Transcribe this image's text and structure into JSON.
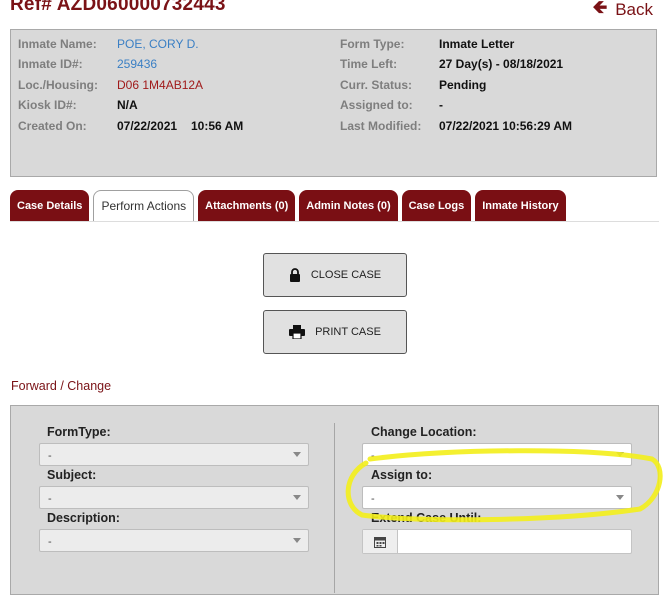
{
  "header": {
    "ref_prefix": "Ref#",
    "ref_number": "AZD060000732443",
    "back_label": "Back",
    "back_icon": "arrow-left-icon"
  },
  "details": {
    "inmate_name_label": "Inmate Name:",
    "inmate_name": "POE, CORY D.",
    "inmate_id_label": "Inmate ID#:",
    "inmate_id": "259436",
    "loc_label": "Loc./Housing:",
    "loc_value": "D06 1M4AB12A",
    "kiosk_label": "Kiosk ID#:",
    "kiosk_value": "N/A",
    "created_label": "Created On:",
    "created_date": "07/22/2021",
    "created_time": "10:56 AM",
    "form_type_label": "Form Type:",
    "form_type": "Inmate Letter",
    "time_left_label": "Time Left:",
    "time_left": "27 Day(s) - 08/18/2021",
    "status_label": "Curr. Status:",
    "status": "Pending",
    "assigned_label": "Assigned to:",
    "assigned": "-",
    "modified_label": "Last Modified:",
    "modified": "07/22/2021 10:56:29 AM"
  },
  "tabs": [
    {
      "label": "Case Details"
    },
    {
      "label": "Perform Actions"
    },
    {
      "label": "Attachments (0)"
    },
    {
      "label": "Admin Notes (0)"
    },
    {
      "label": "Case Logs"
    },
    {
      "label": "Inmate History"
    }
  ],
  "active_tab": "Perform Actions",
  "actions": {
    "close_label": "CLOSE CASE",
    "close_icon": "lock-icon",
    "print_label": "PRINT CASE",
    "print_icon": "printer-icon"
  },
  "forward": {
    "title": "Forward / Change",
    "form_type_label": "FormType:",
    "form_type_value": "-",
    "subject_label": "Subject:",
    "subject_value": "-",
    "description_label": "Description:",
    "description_value": "-",
    "location_label": "Change Location:",
    "location_value": "-",
    "assign_label": "Assign to:",
    "assign_value": "-",
    "extend_label": "Extend Case Until:",
    "extend_value": "",
    "calendar_icon": "calendar-icon"
  },
  "colors": {
    "brand": "#7a1216",
    "tab_bg": "#7a0f14",
    "link": "#3a7fc4",
    "panel": "#d9d9d9",
    "highlight": "#f3ee1a"
  }
}
